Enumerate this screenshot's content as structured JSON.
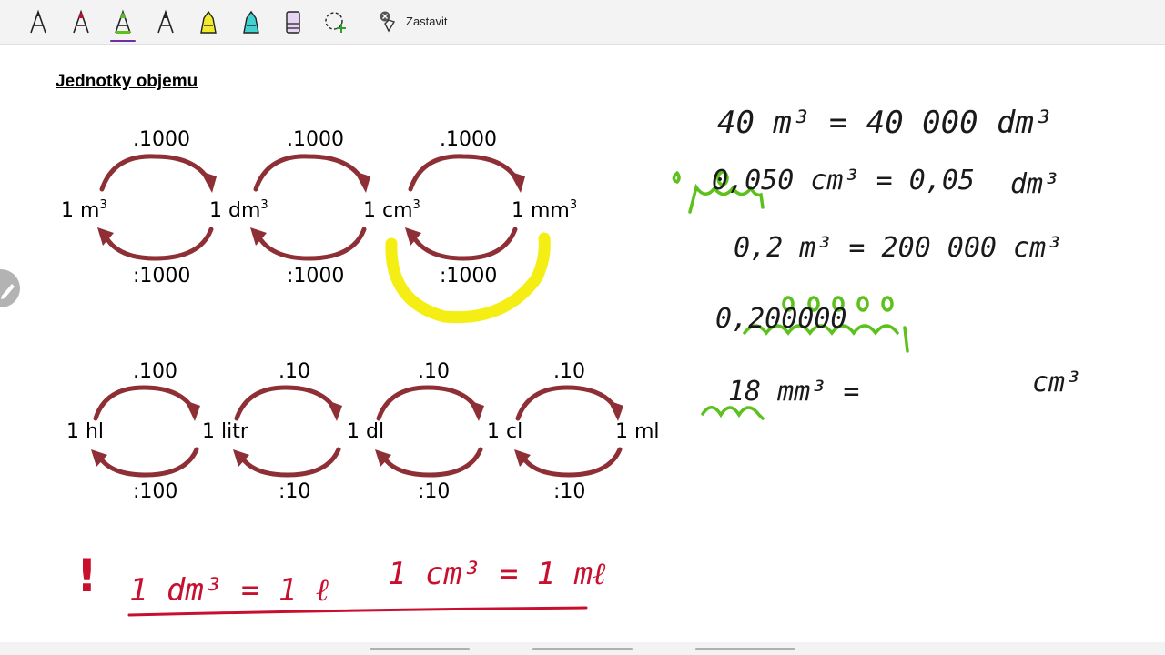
{
  "toolbar": {
    "tools": [
      {
        "name": "pen-black",
        "color": "#222222"
      },
      {
        "name": "pen-red",
        "color": "#c01030"
      },
      {
        "name": "pen-green",
        "color": "#5cc11c",
        "selected_color": "#6f2da8"
      },
      {
        "name": "pen-dark",
        "color": "#222222"
      },
      {
        "name": "highlighter-yellow",
        "color": "#f2ea2a"
      },
      {
        "name": "highlighter-cyan",
        "color": "#42d1d1"
      },
      {
        "name": "eraser",
        "color": "#c9a6e0"
      },
      {
        "name": "lasso-add",
        "color": "#2e9e2e"
      }
    ],
    "stop_label": "Zastavit"
  },
  "page": {
    "title": "Jednotky objemu",
    "volume_chain": {
      "units": [
        {
          "num": "1 ",
          "unit": "m",
          "exp": "3"
        },
        {
          "num": "1 ",
          "unit": "dm",
          "exp": "3"
        },
        {
          "num": "1 ",
          "unit": "cm",
          "exp": "3"
        },
        {
          "num": "1 ",
          "unit": "mm",
          "exp": "3"
        }
      ],
      "multipliers": [
        ".1000",
        ".1000",
        ".1000"
      ],
      "dividers": [
        ":1000",
        ":1000",
        ":1000"
      ]
    },
    "capacity_chain": {
      "units": [
        "1 hl",
        "1 litr",
        "1 dl",
        "1 cl",
        "1 ml"
      ],
      "multipliers": [
        ".100",
        ".10",
        ".10",
        ".10"
      ],
      "dividers": [
        ":100",
        ":10",
        ":10",
        ":10"
      ]
    },
    "handwriting": {
      "note_red": "!",
      "eq_red_1": "1 dm³ = 1 ℓ",
      "eq_red_2": "1 cm³ = 1 mℓ",
      "line1": "40 m³ = 40 000  dm³",
      "line2_left": "0,050 cm³ = 0,05",
      "line2_right": "dm³",
      "line3": "0,2 m³ = 200 000  cm³",
      "line4": "0,200000",
      "line5_left": "18 mm³  =",
      "line5_right": "cm³"
    },
    "colors": {
      "arrow": "#8e2e35",
      "ink_black": "#1a1a1a",
      "ink_green": "#5cc11c",
      "ink_red": "#c8102e",
      "highlight_yellow": "#f5ee14"
    }
  }
}
